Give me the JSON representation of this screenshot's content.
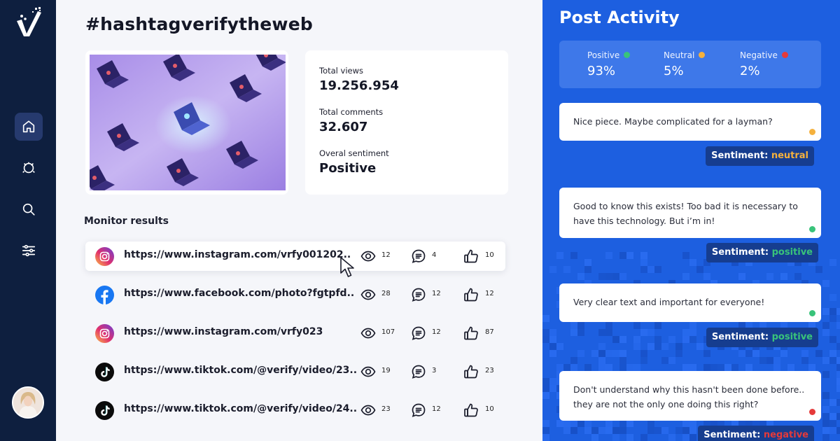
{
  "brand": {
    "logo_icon": "checkmark-logo-icon"
  },
  "sidebar": {
    "items": [
      {
        "name": "home",
        "icon": "home-icon",
        "active": true
      },
      {
        "name": "activity",
        "icon": "bug-icon",
        "active": false
      },
      {
        "name": "search",
        "icon": "search-icon",
        "active": false
      },
      {
        "name": "filters",
        "icon": "sliders-icon",
        "active": false
      }
    ],
    "avatar_icon": "user-avatar"
  },
  "main": {
    "title": "#hashtagverifytheweb",
    "stats": {
      "views_label": "Total views",
      "views_value": "19.256.954",
      "comments_label": "Total comments",
      "comments_value": "32.607",
      "sentiment_label": "Overal sentiment",
      "sentiment_value": "Positive"
    },
    "monitor_label": "Monitor results",
    "results": [
      {
        "platform": "instagram",
        "url": "https://www.instagram.com/vrfy001202..",
        "views": "12",
        "comments": "4",
        "likes": "10"
      },
      {
        "platform": "facebook",
        "url": "https://www.facebook.com/photo?fgtpfd..",
        "views": "28",
        "comments": "12",
        "likes": "12"
      },
      {
        "platform": "instagram",
        "url": "https://www.instagram.com/vrfy023",
        "views": "107",
        "comments": "12",
        "likes": "87"
      },
      {
        "platform": "tiktok",
        "url": "https://www.tiktok.com/@verify/video/23..",
        "views": "19",
        "comments": "3",
        "likes": "23"
      },
      {
        "platform": "tiktok",
        "url": "https://www.tiktok.com/@verify/video/24..",
        "views": "23",
        "comments": "12",
        "likes": "10"
      }
    ]
  },
  "activity": {
    "title": "Post Activity",
    "summary": [
      {
        "label": "Positive",
        "value": "93%",
        "color": "#39c37a"
      },
      {
        "label": "Neutral",
        "value": "5%",
        "color": "#f5b13d"
      },
      {
        "label": "Negative",
        "value": "2%",
        "color": "#e53a3a"
      }
    ],
    "sentiment_prefix": "Sentiment:",
    "comments": [
      {
        "text": "Nice piece. Maybe complicated for a layman?",
        "sentiment": "neutral",
        "color": "#f5b13d"
      },
      {
        "text": "Good to know this exists! Too bad it is necessary to have this technology. But i’m in!",
        "sentiment": "positive",
        "color": "#39c37a"
      },
      {
        "text": "Very clear text and important for everyone!",
        "sentiment": "positive",
        "color": "#39c37a"
      },
      {
        "text": "Don't understand why this hasn't been done before.. they are not the only one doing this right?",
        "sentiment": "negative",
        "color": "#e53a3a"
      }
    ]
  },
  "colors": {
    "sidebar": "#0e1f3f",
    "accent": "#1d5fe0",
    "tag_bg": "#163d8f"
  }
}
